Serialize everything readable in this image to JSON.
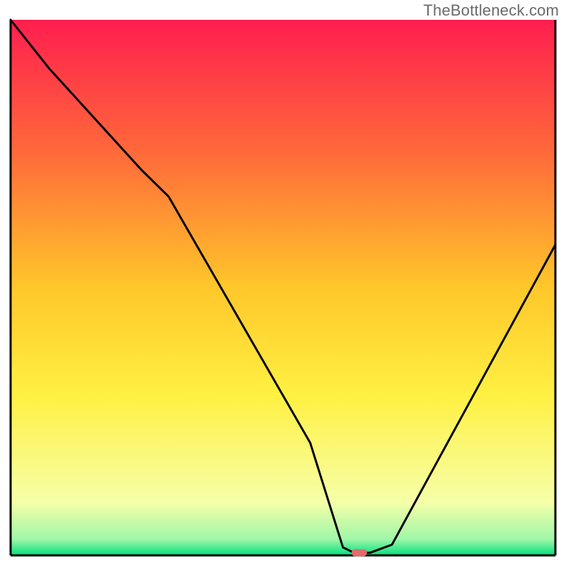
{
  "watermark": "TheBottleneck.com",
  "chart_data": {
    "type": "line",
    "title": "",
    "xlabel": "",
    "ylabel": "",
    "x_range": [
      0,
      100
    ],
    "y_range": [
      0,
      100
    ],
    "grid": false,
    "legend": false,
    "background": {
      "type": "vertical-gradient",
      "stops": [
        {
          "pos": 0,
          "color": "#ff1e4f"
        },
        {
          "pos": 25,
          "color": "#ff6a3a"
        },
        {
          "pos": 50,
          "color": "#ffc72a"
        },
        {
          "pos": 70,
          "color": "#fff042"
        },
        {
          "pos": 90,
          "color": "#f6ffa8"
        },
        {
          "pos": 97,
          "color": "#9ff7a8"
        },
        {
          "pos": 100,
          "color": "#00e07d"
        }
      ]
    },
    "series": [
      {
        "name": "bottleneck-curve",
        "x": [
          0,
          7,
          24,
          29,
          55,
          59,
          61,
          63,
          66,
          70,
          100
        ],
        "values": [
          100,
          91,
          72,
          67,
          21,
          8,
          1.5,
          0.5,
          0.5,
          2,
          58
        ]
      }
    ],
    "marker": {
      "x": 64,
      "y": 0.5,
      "color": "#e46a6a",
      "shape": "pill"
    },
    "axes": {
      "show_ticks": false,
      "border": {
        "left": true,
        "right": true,
        "bottom": true,
        "top": false,
        "color": "#000000",
        "width": 3
      }
    }
  }
}
